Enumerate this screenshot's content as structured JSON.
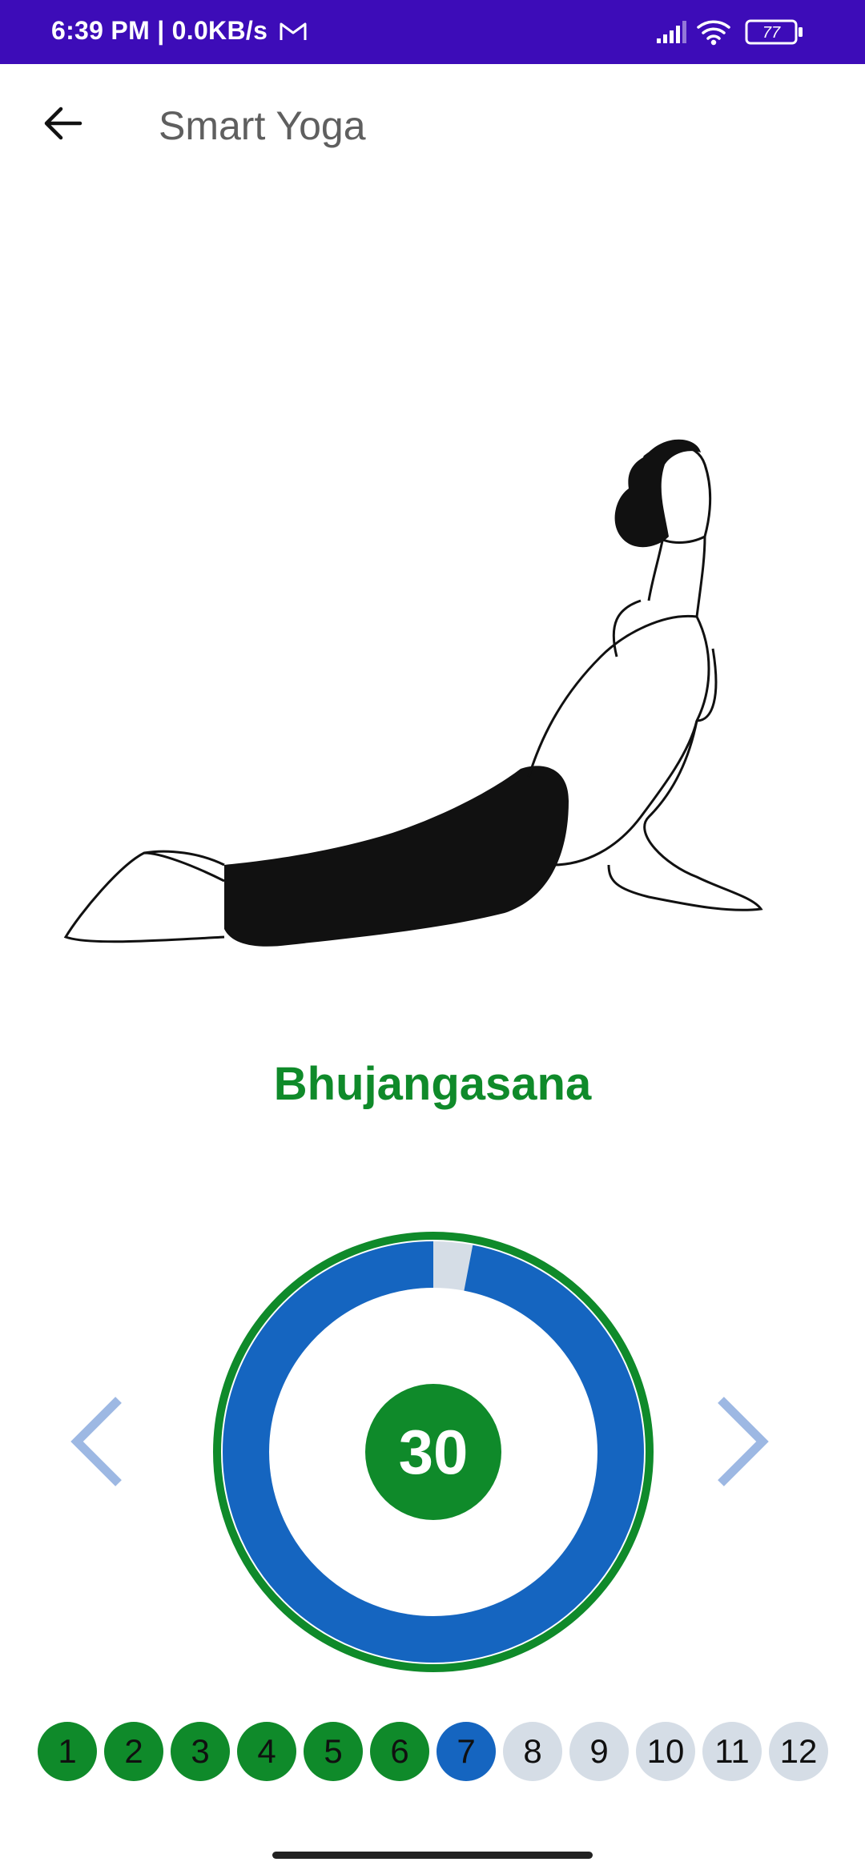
{
  "status_bar": {
    "time_text": "6:39 PM | 0.0KB/s",
    "mail_icon": "gmail-icon",
    "battery_level": "77",
    "icons": [
      "signal-icon",
      "wifi-icon",
      "battery-icon"
    ]
  },
  "app_bar": {
    "back_icon": "arrow-back-icon",
    "title": "Smart Yoga"
  },
  "pose": {
    "illustration": "cobra-pose-illustration",
    "name": "Bhujangasana"
  },
  "timer": {
    "remaining": "30",
    "progress_fraction": 0.97,
    "colors": {
      "outer_ring": "#0f8a2a",
      "progress": "#1565c0",
      "track": "#d5dde6"
    }
  },
  "navigation": {
    "prev_icon": "chevron-left-icon",
    "next_icon": "chevron-right-icon"
  },
  "steps": [
    {
      "label": "1",
      "state": "done"
    },
    {
      "label": "2",
      "state": "done"
    },
    {
      "label": "3",
      "state": "done"
    },
    {
      "label": "4",
      "state": "done"
    },
    {
      "label": "5",
      "state": "done"
    },
    {
      "label": "6",
      "state": "done"
    },
    {
      "label": "7",
      "state": "current"
    },
    {
      "label": "8",
      "state": "todo"
    },
    {
      "label": "9",
      "state": "todo"
    },
    {
      "label": "10",
      "state": "todo"
    },
    {
      "label": "11",
      "state": "todo"
    },
    {
      "label": "12",
      "state": "todo"
    }
  ],
  "colors": {
    "status_bar": "#3d0cb8",
    "accent_green": "#0f8a2a",
    "accent_blue": "#1565c0",
    "nav_arrow": "#9db8e3"
  }
}
